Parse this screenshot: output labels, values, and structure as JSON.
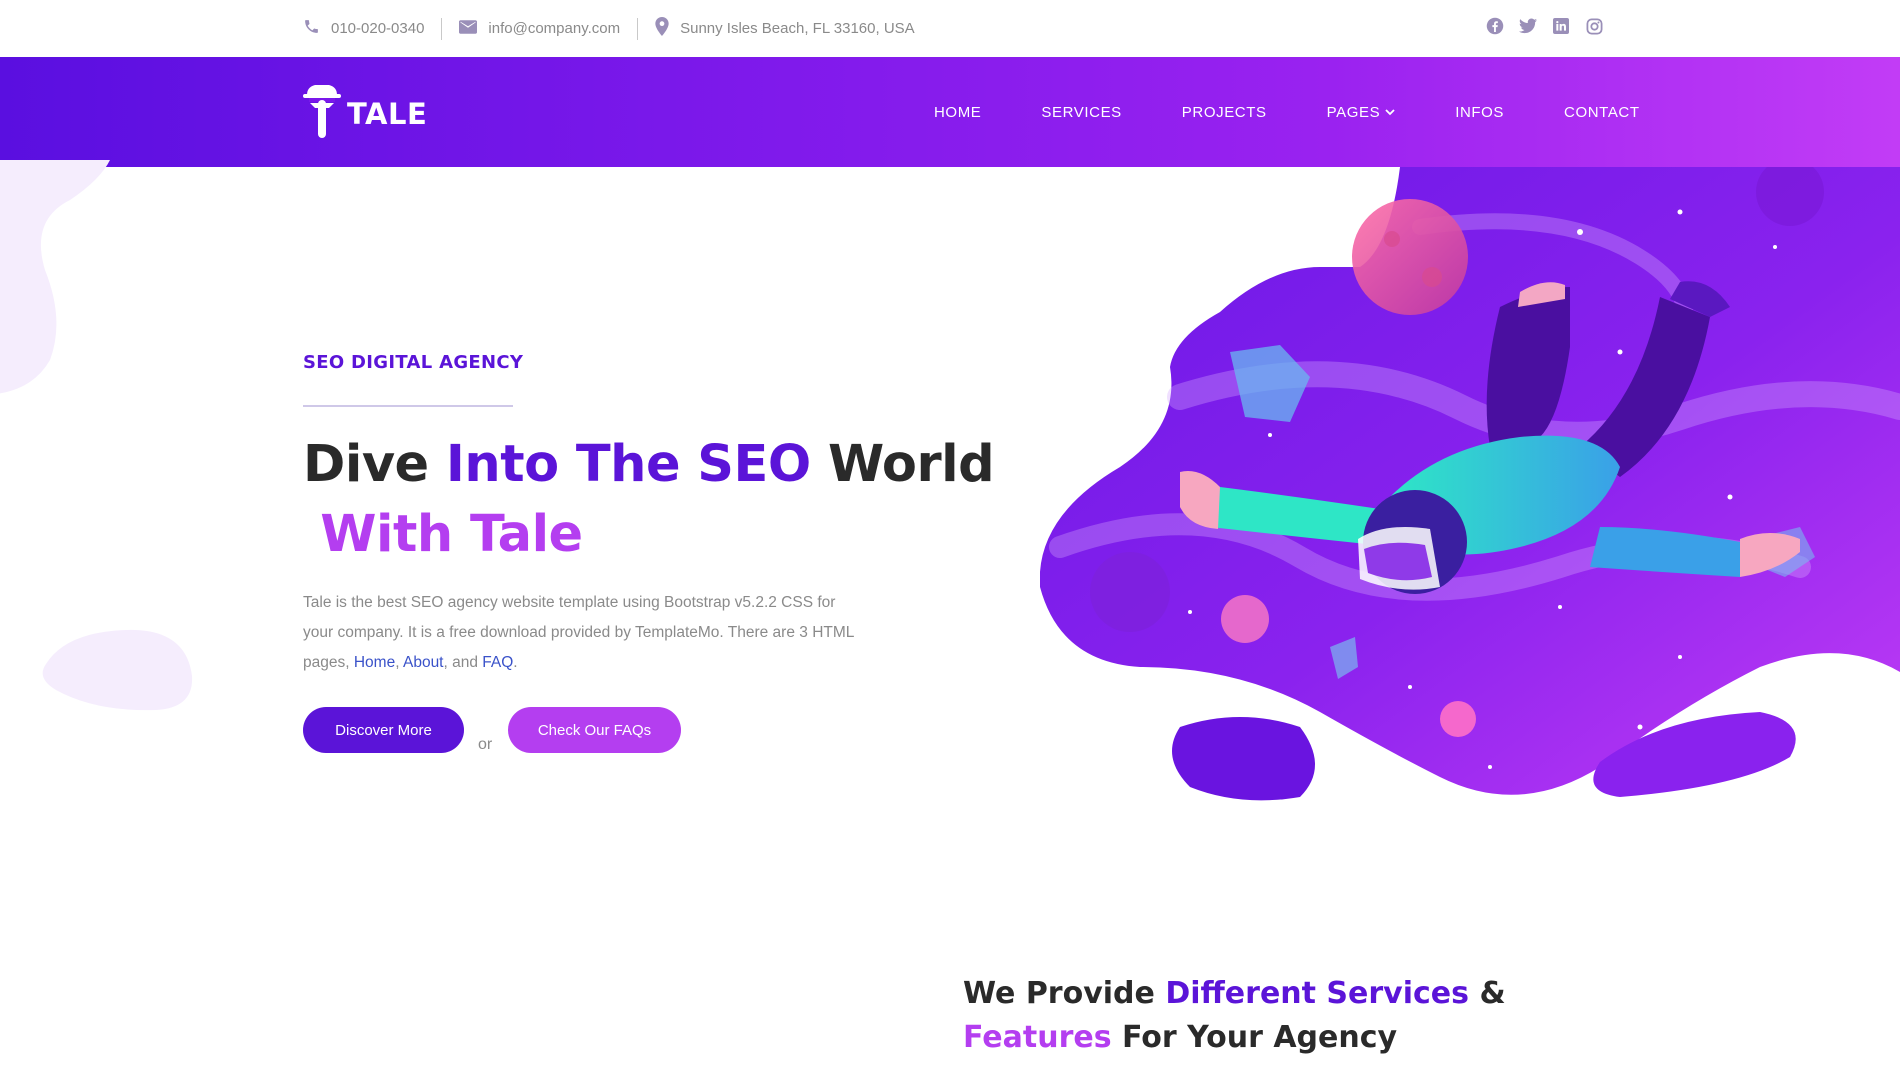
{
  "topbar": {
    "phone": "010-020-0340",
    "email": "info@company.com",
    "address": "Sunny Isles Beach, FL 33160, USA",
    "social": [
      {
        "icon": "facebook-icon"
      },
      {
        "icon": "twitter-icon"
      },
      {
        "icon": "linkedin-icon"
      },
      {
        "icon": "instagram-icon"
      }
    ]
  },
  "header": {
    "brand": "TALE",
    "nav": [
      "HOME",
      "SERVICES",
      "PROJECTS",
      "PAGES",
      "INFOS",
      "CONTACT"
    ]
  },
  "hero": {
    "subtitle": "SEO DIGITAL AGENCY",
    "title_part1": "Dive ",
    "title_part2": "Into The SEO",
    "title_part3": " World",
    "title_part4": "With Tale",
    "desc_text": "Tale is the best SEO agency website template using Bootstrap v5.2.2 CSS for your company. It is a free download provided by TemplateMo. There are 3 HTML pages, ",
    "link_home": "Home",
    "comma": ", ",
    "link_about": "About",
    "and_text": ", and ",
    "link_faq": "FAQ",
    "period": ".",
    "btn_discover": "Discover More",
    "or": "or",
    "btn_faqs": "Check Our FAQs"
  },
  "services": {
    "title_part1": "We Provide ",
    "title_part2": "Different Services",
    "title_part3": " &",
    "title_part4": "Features",
    "title_part5": " For Your Agency"
  },
  "colors": {
    "primary": "#5b14d8",
    "secondary": "#b43ef0",
    "header_start": "#5a0fe0",
    "header_end": "#c23cf6"
  }
}
